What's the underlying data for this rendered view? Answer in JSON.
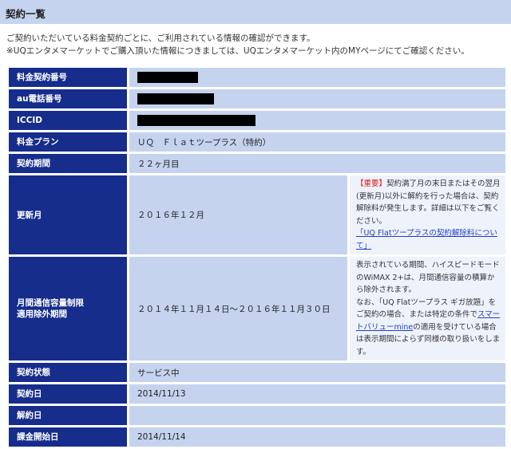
{
  "header": {
    "title": "契約一覧"
  },
  "description": {
    "line1": "ご契約いただいている料金契約ごとに、ご利用されている情報の確認ができます。",
    "line2": "※UQエンタメマーケットでご購入頂いた情報につきましては、UQエンタメマーケット内のMYページにてご確認ください。"
  },
  "contract": {
    "rows": {
      "fee_number": {
        "label": "料金契約番号",
        "value": ""
      },
      "au_phone": {
        "label": "au電話番号",
        "value": ""
      },
      "iccid": {
        "label": "ICCID",
        "value": ""
      },
      "plan": {
        "label": "料金プラン",
        "value": "ＵＱ　Ｆｌａｔツープラス（特約）"
      },
      "period": {
        "label": "契約期間",
        "value": "２２ヶ月目"
      },
      "renewal": {
        "label": "更新月",
        "value": "２０１６年１２月"
      },
      "exclusion": {
        "label_line1": "月間通信容量制限",
        "label_line2": "適用除外期間",
        "value": "２０１４年１１月１４日～２０１６年１１月３０日"
      },
      "status": {
        "label": "契約状態",
        "value": "サービス中"
      },
      "contract_date": {
        "label": "契約日",
        "value": "2014/11/13"
      },
      "cancel_date": {
        "label": "解約日",
        "value": ""
      },
      "billing_start": {
        "label": "課金開始日",
        "value": "2014/11/14"
      }
    },
    "renewal_note": {
      "tag": "【重要】",
      "text": "契約満了月の末日またはその翌月(更新月)以外に解約を行った場合は、契約解除料が発生します。詳細は以下をご覧ください。",
      "link": "「UQ Flatツープラスの契約解除料について」"
    },
    "exclusion_note": {
      "text1": "表示されている期間、ハイスピードモードのWiMAX 2+は、月間通信容量の積算から除外されます。",
      "text2": "なお、「UQ Flatツープラス ギガ放題」をご契約の場合、または特定の条件で",
      "link": "スマートバリューmine",
      "text3": "の適用を受けている場合は表示期間によらず同様の取り扱いをします。"
    }
  }
}
